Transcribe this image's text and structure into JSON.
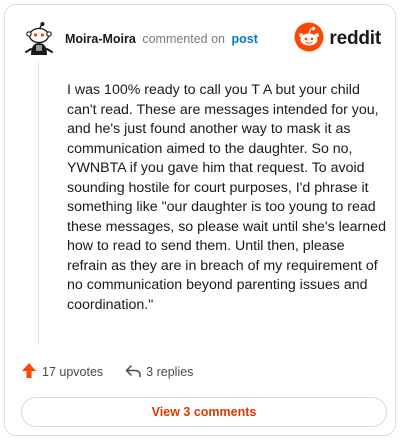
{
  "comment": {
    "username": "Moira-Moira",
    "action_text": "commented on",
    "post_link_label": "post",
    "body": "I was 100% ready to call you T A but your child can't read. These are messages intended for you, and he's just found another way to mask it as communication aimed to the daughter. So no, YWNBTA if you gave him that request. To avoid sounding hostile for court purposes, I'd phrase it something like \"our daughter is too young to read these messages, so please wait until she's learned how to read to send them. Until then, please refrain as they are in breach of my requirement of no communication beyond parenting issues and coordination.\"",
    "upvotes_label": "17 upvotes",
    "replies_label": "3 replies"
  },
  "brand": {
    "name": "reddit"
  },
  "footer": {
    "view_comments_label": "View 3 comments"
  },
  "icons": {
    "avatar": "snoo-avatar-icon",
    "logo": "reddit-logo-icon",
    "upvote": "upvote-arrow-icon",
    "reply": "reply-arrow-icon"
  },
  "colors": {
    "accent": "#ff4500",
    "link": "#0079d3",
    "button_text": "#d93a00"
  }
}
